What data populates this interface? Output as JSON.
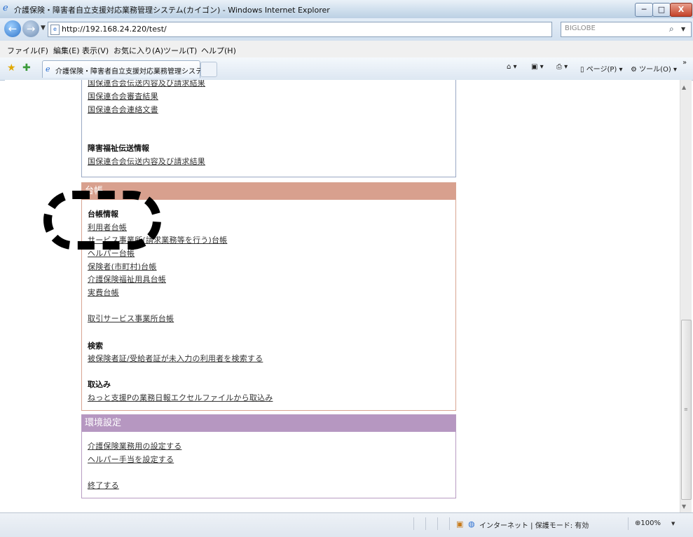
{
  "window": {
    "title": "介護保険・障害者自立支援対応業務管理システム(カイゴン) - Windows Internet Explorer",
    "min": "─",
    "max": "□",
    "close": "X"
  },
  "address": {
    "url": "http://192.168.24.220/test/",
    "search_placeholder": "BIGLOBE"
  },
  "menu": [
    "ファイル(F)",
    "編集(E)",
    "表示(V)",
    "お気に入り(A)",
    "ツール(T)",
    "ヘルプ(H)"
  ],
  "tab": {
    "label": "介護保険・障害者自立支援対応業務管理システ..."
  },
  "commands": {
    "page": "ページ(P)",
    "tools": "ツール(O)",
    "more": "»"
  },
  "top_panel": {
    "links": [
      "国保連合会伝送内容及び請求結果",
      "国保連合会審査結果",
      "国保連合会連絡文書"
    ],
    "section": "障害福祉伝送情報",
    "section_links": [
      "国保連合会伝送内容及び請求結果"
    ]
  },
  "ledger_panel": {
    "header": "台帳",
    "section1": "台帳情報",
    "links1": [
      "利用者台帳",
      "サービス事業所(請求業務等を行う)台帳",
      "ヘルパー台帳",
      "保険者(市町村)台帳",
      "介護保険福祉用具台帳",
      "実費台帳"
    ],
    "link_trade": "取引サービス事業所台帳",
    "section2": "検索",
    "search_link": "被保険者証/受給者証が未入力の利用者を検索する",
    "section3": "取込み",
    "import_link": "ねっと支援Pの業務日報エクセルファイルから取込み"
  },
  "env_panel": {
    "header": "環境設定",
    "links": [
      "介護保険業務用の設定する",
      "ヘルパー手当を設定する"
    ],
    "exit": "終了する"
  },
  "status": {
    "zone": "インターネット | 保護モード: 有効",
    "zoom": "100%"
  },
  "colors": {
    "ledger_header": "#d8a08e",
    "env_header": "#b697c1",
    "top_border": "#9aa8c4"
  }
}
